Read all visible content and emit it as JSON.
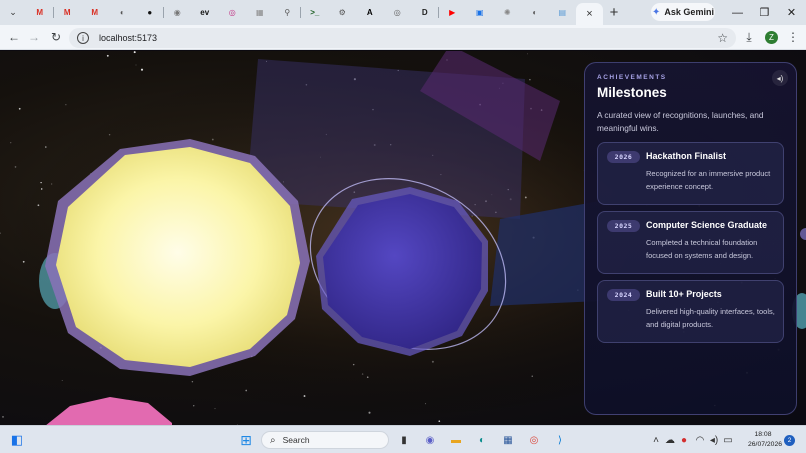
{
  "browser": {
    "pinned_tabs": [
      {
        "icon": "gmail-icon",
        "glyph": "M",
        "color": "#d93025"
      },
      {
        "icon": "gmail-icon",
        "glyph": "M",
        "color": "#d93025"
      },
      {
        "icon": "gmail-icon",
        "glyph": "M",
        "color": "#d93025"
      },
      {
        "icon": "globe-icon",
        "glyph": "◐",
        "color": "#555555"
      },
      {
        "icon": "github-icon",
        "glyph": "●",
        "color": "#111111"
      },
      {
        "icon": "chat-icon",
        "glyph": "◉",
        "color": "#777777"
      },
      {
        "icon": "ev-icon",
        "glyph": "ev",
        "color": "#111111"
      },
      {
        "icon": "instagram-icon",
        "glyph": "◎",
        "color": "#c13584"
      },
      {
        "icon": "grid-icon",
        "glyph": "▦",
        "color": "#888888"
      },
      {
        "icon": "pin-icon",
        "glyph": "⚲",
        "color": "#555555"
      },
      {
        "icon": "terminal-icon",
        "glyph": ">_",
        "color": "#1b5e20"
      },
      {
        "icon": "settings-icon",
        "glyph": "⚙",
        "color": "#555555"
      },
      {
        "icon": "circle-a-icon",
        "glyph": "A",
        "color": "#000000"
      },
      {
        "icon": "lens-icon",
        "glyph": "◎",
        "color": "#666666"
      },
      {
        "icon": "d-icon",
        "glyph": "D",
        "color": "#222222"
      },
      {
        "icon": "youtube-icon",
        "glyph": "▶",
        "color": "#ff0000"
      },
      {
        "icon": "figma-icon",
        "glyph": "▣",
        "color": "#1a73e8"
      },
      {
        "icon": "sun-icon",
        "glyph": "✺",
        "color": "#888888"
      },
      {
        "icon": "globe-icon",
        "glyph": "◐",
        "color": "#555555"
      },
      {
        "icon": "board-icon",
        "glyph": "▤",
        "color": "#5b9bd5"
      }
    ],
    "active_tab_close": "×",
    "new_tab": "+",
    "gemini_label": "Ask Gemini",
    "url": "localhost:5173",
    "profile_initial": "Z"
  },
  "panel": {
    "eyebrow": "ACHIEVEMENTS",
    "title": "Milestones",
    "description": "A curated view of recognitions, launches, and meaningful wins.",
    "milestones": [
      {
        "year": "2026",
        "title": "Hackathon Finalist",
        "description": "Recognized for an immersive product experience concept."
      },
      {
        "year": "2025",
        "title": "Computer Science Graduate",
        "description": "Completed a technical foundation focused on systems and design."
      },
      {
        "year": "2024",
        "title": "Built 10+ Projects",
        "description": "Delivered high-quality interfaces, tools, and digital products."
      }
    ]
  },
  "taskbar": {
    "search_placeholder": "Search",
    "time": "18:08",
    "date": "26/07/2026",
    "notification_count": "2"
  },
  "colors": {
    "sun": "#fbf7b8",
    "planet": "#4a3fb0",
    "panel_accent": "#a7a3e6",
    "pink_planet": "#e26ab0"
  }
}
